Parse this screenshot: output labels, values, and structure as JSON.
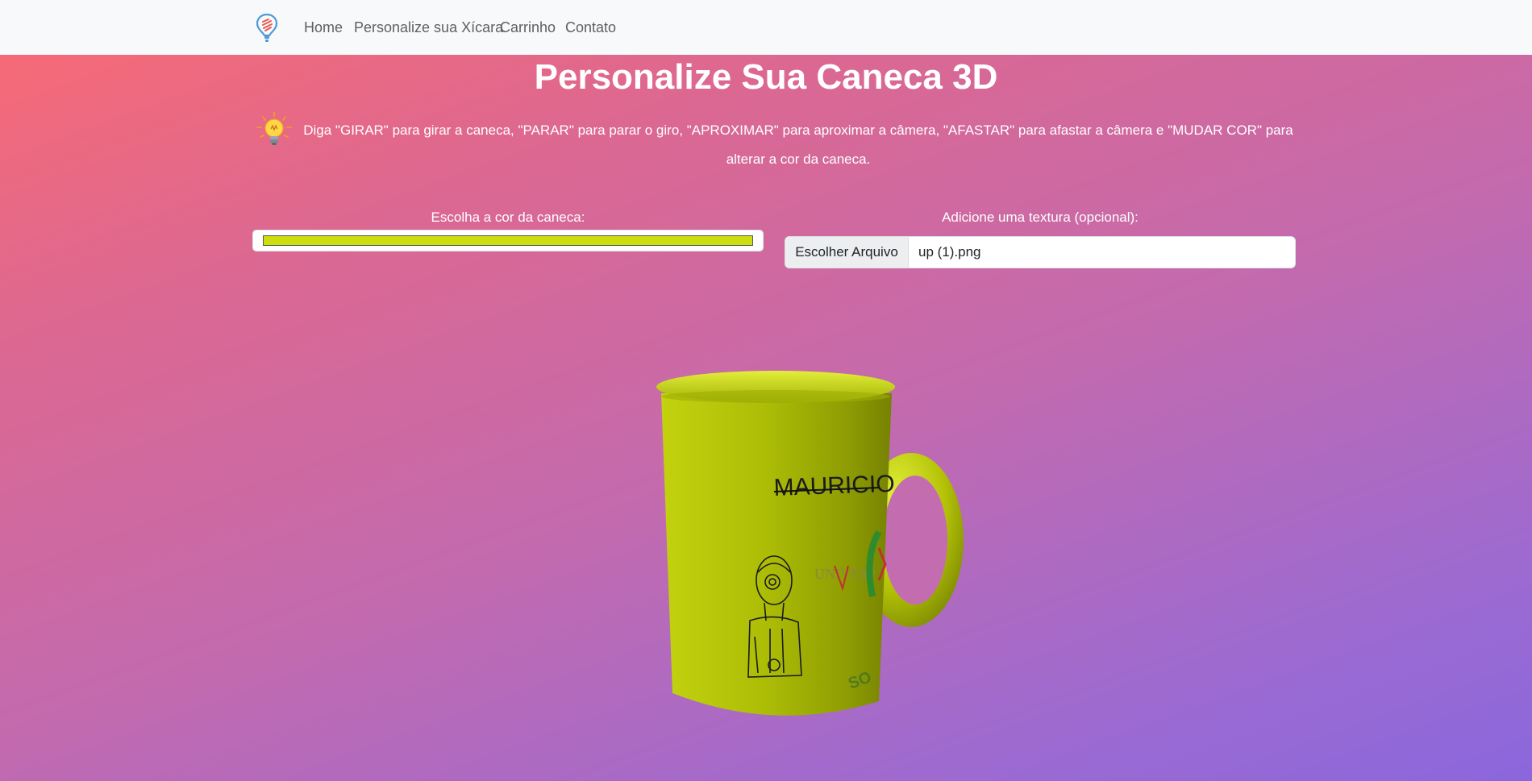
{
  "nav": {
    "brand_icon": "lightbulb-pin-icon",
    "links": [
      "Home",
      "Personalize sua Xícara",
      "Carrinho",
      "Contato"
    ]
  },
  "page": {
    "title": "Personalize Sua Caneca 3D",
    "tip_icon": "lightbulb-icon",
    "instructions": "Diga \"GIRAR\" para girar a caneca, \"PARAR\" para parar o giro, \"APROXIMAR\" para aproximar a câmera, \"AFASTAR\" para afastar a câmera e \"MUDAR COR\" para alterar a cor da caneca."
  },
  "color_picker": {
    "label": "Escolha a cor da caneca:",
    "value": "#ccde0e"
  },
  "texture": {
    "label": "Adicione uma textura (opcional):",
    "button_label": "Escolher Arquivo",
    "file_name": "up (1).png"
  },
  "mug": {
    "color": "#b8c80a",
    "texture_text": "MAURICIO",
    "texture_logo_text": "UNIVESP"
  },
  "colors": {
    "navbar_bg": "#f8f9fa",
    "gradient_start": "#fb6b72",
    "gradient_end": "#8b67dc"
  }
}
